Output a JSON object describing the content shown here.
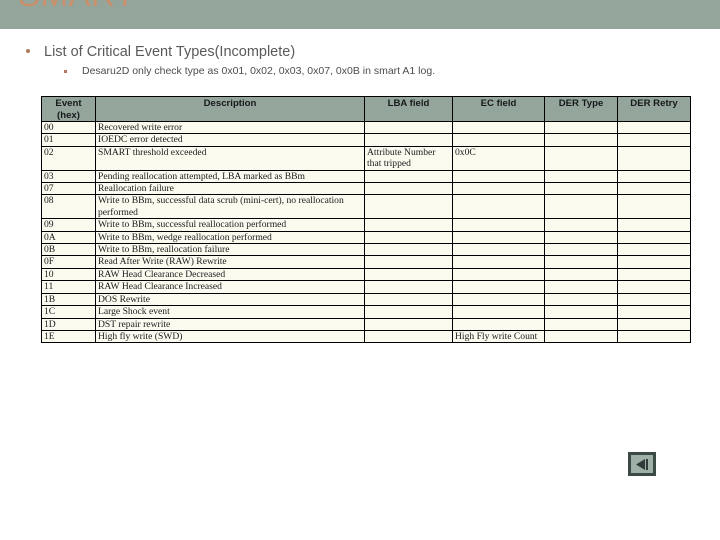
{
  "slide": {
    "title": "SMART",
    "banner_color": "#94a59c",
    "title_color": "#c98f6a",
    "background_color": "#ffffff"
  },
  "bullets": {
    "level1": "List of Critical Event Types(Incomplete)",
    "level2": "Desaru2D only check type as 0x01, 0x02, 0x03, 0x07, 0x0B in smart A1 log."
  },
  "table": {
    "headers": [
      "Event (hex)",
      "Description",
      "LBA field",
      "EC field",
      "DER Type",
      "DER Retry"
    ],
    "header_event_line1": "Event",
    "header_event_line2": "(hex)",
    "header_description": "Description",
    "header_lba": "LBA field",
    "header_ec": "EC field",
    "header_der_type": "DER Type",
    "header_der_retry": "DER Retry",
    "highlight_color": "#c00000",
    "header_bg": "#94a59c",
    "cell_bg": "#fbfaef",
    "rows": [
      {
        "event": "00",
        "description": "Recovered write error",
        "lba": "",
        "ec": "",
        "der_type": "",
        "der_retry": "",
        "highlighted": false
      },
      {
        "event": "01",
        "description": "IOEDC error detected",
        "lba": "",
        "ec": "",
        "der_type": "",
        "der_retry": "",
        "highlighted": true
      },
      {
        "event": "02",
        "description": "SMART threshold exceeded",
        "lba": "Attribute Number that tripped",
        "ec": "0x0C",
        "der_type": "",
        "der_retry": "",
        "highlighted": true
      },
      {
        "event": "03",
        "description": "Pending reallocation attempted, LBA marked as BBm",
        "lba": "",
        "ec": "",
        "der_type": "",
        "der_retry": "",
        "highlighted": true
      },
      {
        "event": "07",
        "description": "Reallocation failure",
        "lba": "",
        "ec": "",
        "der_type": "",
        "der_retry": "",
        "highlighted": true
      },
      {
        "event": "08",
        "description": "Write to BBm, successful data scrub (mini-cert), no reallocation performed",
        "lba": "",
        "ec": "",
        "der_type": "",
        "der_retry": "",
        "highlighted": false
      },
      {
        "event": "09",
        "description": "Write to BBm, successful reallocation performed",
        "lba": "",
        "ec": "",
        "der_type": "",
        "der_retry": "",
        "highlighted": false
      },
      {
        "event": "0A",
        "description": "Write to BBm, wedge reallocation performed",
        "lba": "",
        "ec": "",
        "der_type": "",
        "der_retry": "",
        "highlighted": false
      },
      {
        "event": "0B",
        "description": "Write to BBm, reallocation failure",
        "lba": "",
        "ec": "",
        "der_type": "",
        "der_retry": "",
        "highlighted": true
      },
      {
        "event": "0F",
        "description": "Read After Write (RAW) Rewrite",
        "lba": "",
        "ec": "",
        "der_type": "",
        "der_retry": "",
        "highlighted": false
      },
      {
        "event": "10",
        "description": "RAW Head Clearance Decreased",
        "lba": "",
        "ec": "",
        "der_type": "",
        "der_retry": "",
        "highlighted": false
      },
      {
        "event": "11",
        "description": "RAW Head Clearance Increased",
        "lba": "",
        "ec": "",
        "der_type": "",
        "der_retry": "",
        "highlighted": false
      },
      {
        "event": "1B",
        "description": "DOS Rewrite",
        "lba": "",
        "ec": "",
        "der_type": "",
        "der_retry": "",
        "highlighted": false
      },
      {
        "event": "1C",
        "description": "Large Shock event",
        "lba": "",
        "ec": "",
        "der_type": "",
        "der_retry": "",
        "highlighted": false
      },
      {
        "event": "1D",
        "description": "DST repair rewrite",
        "lba": "",
        "ec": "",
        "der_type": "",
        "der_retry": "",
        "highlighted": false
      },
      {
        "event": "1E",
        "description": "High fly write (SWD)",
        "lba": "",
        "ec": "High Fly write Count",
        "der_type": "",
        "der_retry": "",
        "highlighted": false
      }
    ]
  },
  "navigation": {
    "back_label": "Previous slide"
  }
}
